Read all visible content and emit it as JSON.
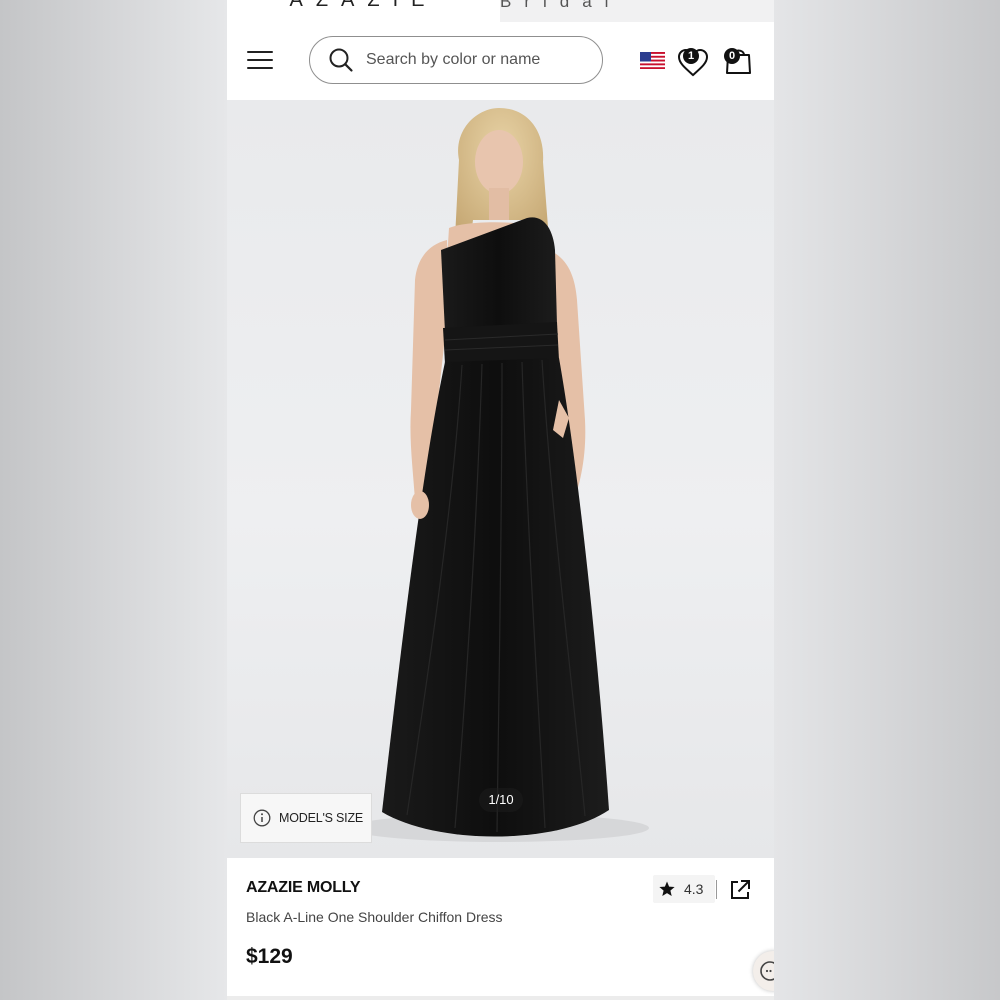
{
  "brand_tabs": [
    {
      "label": "AZAZIE"
    },
    {
      "label": "AZAZIE Bridal"
    }
  ],
  "header": {
    "search_placeholder": "Search by color or name",
    "wishlist_count": "1",
    "cart_count": "0"
  },
  "gallery": {
    "counter": "1/10",
    "model_size_label": "MODEL'S SIZE"
  },
  "product": {
    "brand_name": "AZAZIE MOLLY",
    "name": "Black A-Line One Shoulder Chiffon Dress",
    "price": "$129",
    "rating": "4.3"
  },
  "colors": {
    "dress": "#111111",
    "background": "#ebecee",
    "accent": "#111111"
  }
}
